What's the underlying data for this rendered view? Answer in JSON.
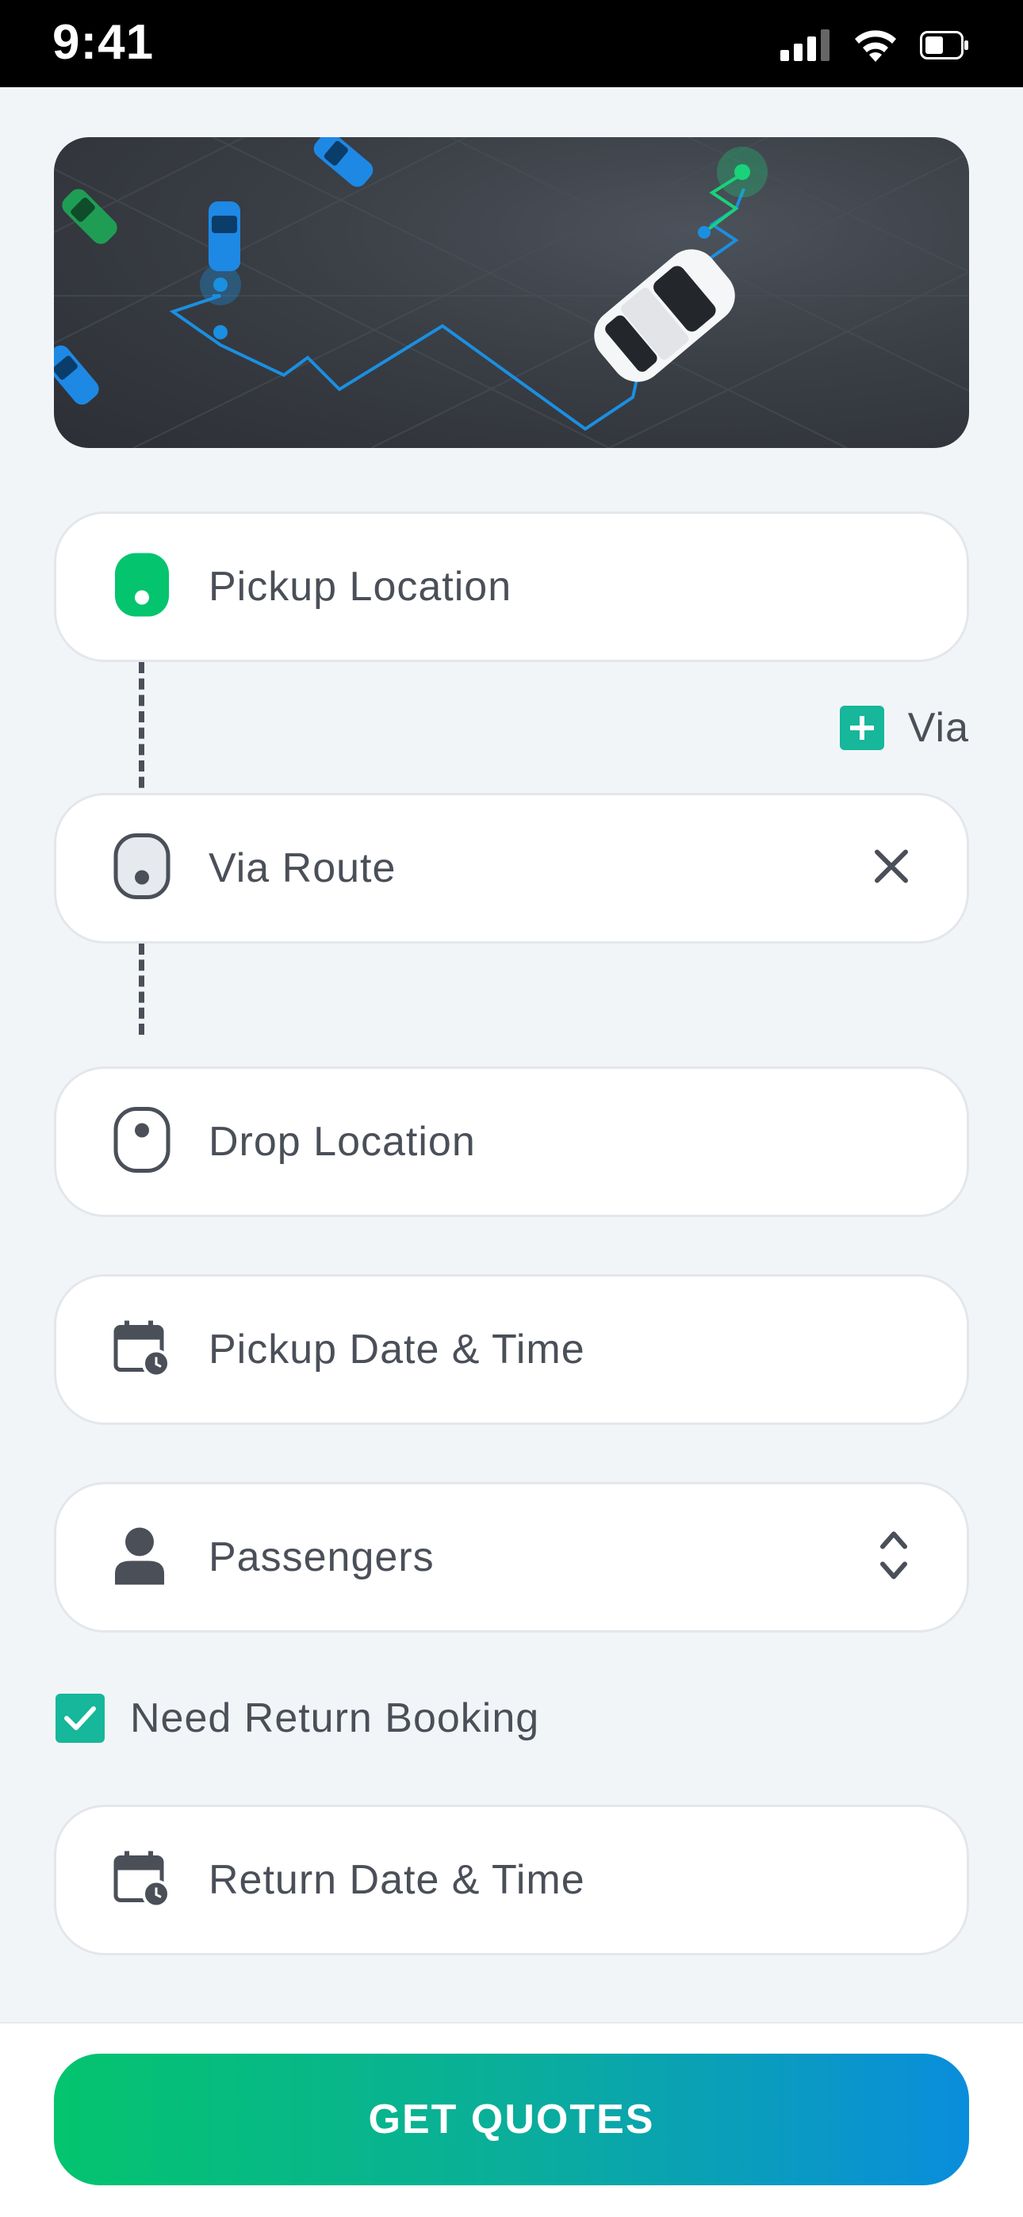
{
  "status_bar": {
    "time": "9:41"
  },
  "form": {
    "pickup_location": {
      "placeholder": "Pickup Location",
      "icon": "pickup-pin-icon"
    },
    "via_link": {
      "label": "Via",
      "icon": "plus-icon"
    },
    "via_route": {
      "placeholder": "Via Route",
      "icon": "via-pin-icon",
      "clear_icon": "close-icon"
    },
    "drop_location": {
      "placeholder": "Drop Location",
      "icon": "drop-pin-icon"
    },
    "pickup_datetime": {
      "placeholder": "Pickup Date & Time",
      "icon": "calendar-clock-icon"
    },
    "passengers": {
      "placeholder": "Passengers",
      "icon": "person-icon",
      "selector_icon": "chevron-up-down-icon"
    },
    "return_booking": {
      "label": "Need Return Booking",
      "checked": true
    },
    "return_datetime": {
      "placeholder": "Return Date & Time",
      "icon": "calendar-clock-icon"
    }
  },
  "cta": {
    "label": "GET QUOTES"
  },
  "colors": {
    "accent_green": "#04c46e",
    "accent_teal": "#16b79a",
    "accent_blue": "#0a8ddc",
    "route_blue": "#1b8fe0",
    "text": "#4a4f58",
    "background": "#f2f5f8"
  }
}
